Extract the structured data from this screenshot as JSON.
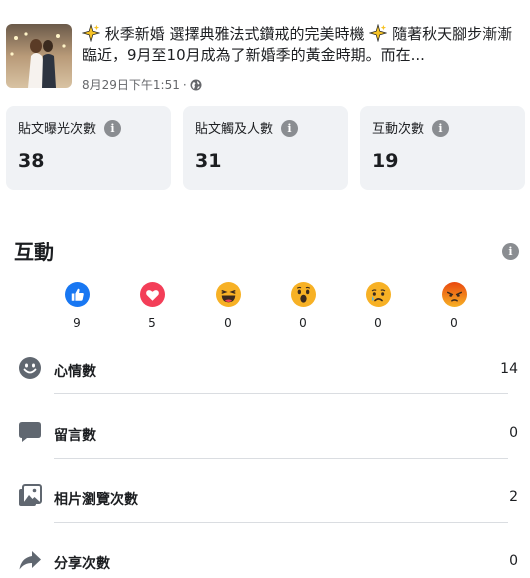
{
  "post": {
    "text_prefix": "秋季新婚 選擇典雅法式鑽戒的完美時機",
    "text_suffix": "隨著秋天腳步漸漸臨近，9月至10月成為了新婚季的黃金時期。而在...",
    "timestamp": "8月29日下午1:51",
    "separator": "·",
    "privacy_icon": "globe-icon"
  },
  "stats": [
    {
      "label": "貼文曝光次數",
      "value": "38"
    },
    {
      "label": "貼文觸及人數",
      "value": "31"
    },
    {
      "label": "互動次數",
      "value": "19"
    }
  ],
  "interactions": {
    "title": "互動",
    "reactions": [
      {
        "icon": "like-icon",
        "count": "9"
      },
      {
        "icon": "love-icon",
        "count": "5"
      },
      {
        "icon": "haha-icon",
        "count": "0"
      },
      {
        "icon": "wow-icon",
        "count": "0"
      },
      {
        "icon": "sad-icon",
        "count": "0"
      },
      {
        "icon": "angry-icon",
        "count": "0"
      }
    ],
    "metrics": [
      {
        "icon": "smiley-icon",
        "label": "心情數",
        "value": "14"
      },
      {
        "icon": "comment-icon",
        "label": "留言數",
        "value": "0"
      },
      {
        "icon": "photo-icon",
        "label": "相片瀏覽次數",
        "value": "2"
      },
      {
        "icon": "share-icon",
        "label": "分享次數",
        "value": "0"
      }
    ]
  },
  "colors": {
    "card_bg": "#f0f2f5",
    "info_icon": "#8a8d91",
    "like_blue": "#1877f2",
    "love_red": "#f33e58",
    "emoji_yellow": "#f7b125",
    "angry_red": "#e9710f",
    "metric_icon": "#606770"
  }
}
